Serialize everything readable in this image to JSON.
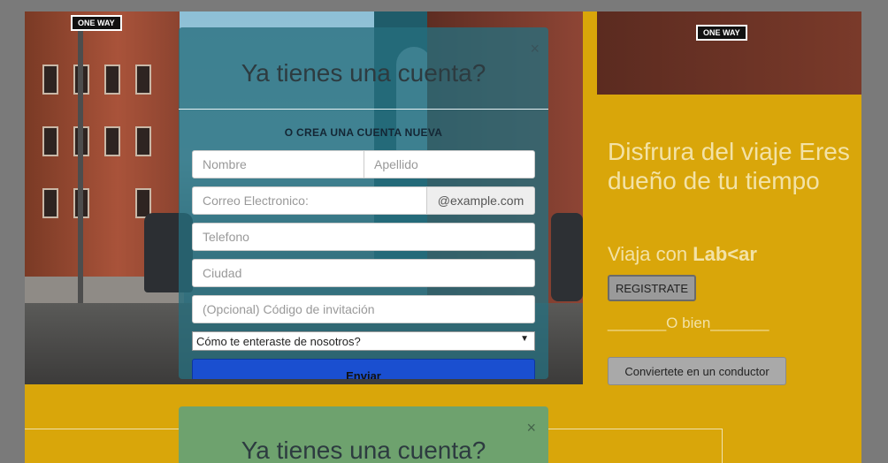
{
  "modal": {
    "title": "Ya tienes una cuenta?",
    "close_glyph": "×",
    "subtitle": "O CREA UNA CUENTA NUEVA",
    "fields": {
      "nombre_placeholder": "Nombre",
      "apellido_placeholder": "Apellido",
      "correo_placeholder": "Correo Electronico:",
      "correo_addon": "@example.com",
      "telefono_placeholder": "Telefono",
      "ciudad_placeholder": "Ciudad",
      "codigo_placeholder": "(Opcional) Código de invitación"
    },
    "select": {
      "selected": "Cómo te enteraste de nosotros?",
      "arrow": "▼"
    },
    "submit_label": "Enviar"
  },
  "promo": {
    "headline": "Disfrura del viaje Eres dueño de tu tiempo",
    "viaja_prefix": "Viaja con ",
    "brand": "Lab<ar",
    "register_label": "REGISTRATE",
    "or_text": "_______O bien_______",
    "driver_label": "Conviertete en un conductor"
  },
  "modal_secondary": {
    "title": "Ya tienes una cuenta?",
    "close_glyph": "×"
  },
  "street_signs": {
    "left": "ONE WAY",
    "right": "ONE WAY"
  },
  "icons": {
    "close": "close-icon",
    "dropdown": "chevron-down-icon"
  },
  "colors": {
    "accent": "#d9a60a",
    "submit": "#1a4fd0",
    "modal_bg": "#266e7d"
  }
}
